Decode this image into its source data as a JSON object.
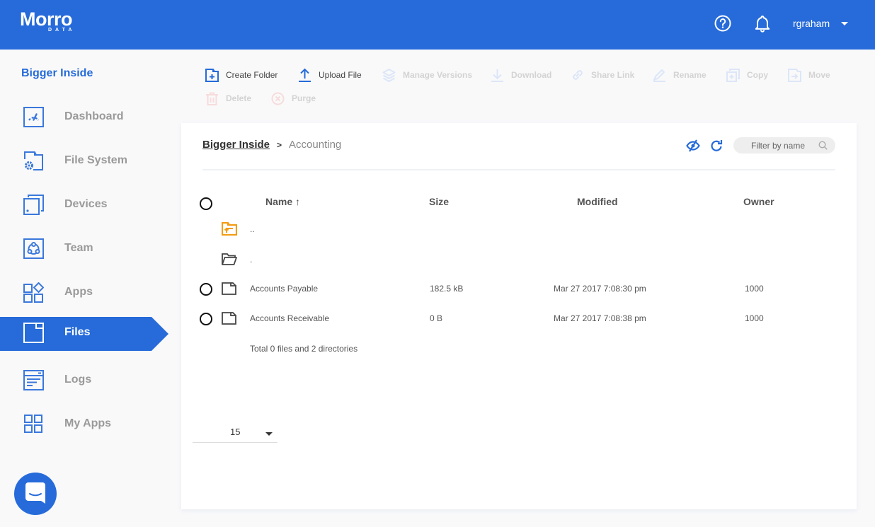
{
  "header": {
    "logo_text": "Morro",
    "logo_subtext": "DATA",
    "username": "rgraham",
    "brand_color": "#266bd9"
  },
  "sidebar": {
    "org_name": "Bigger Inside",
    "items": [
      {
        "label": "Dashboard",
        "icon": "dashboard-icon",
        "active": false
      },
      {
        "label": "File System",
        "icon": "file-system-icon",
        "active": false
      },
      {
        "label": "Devices",
        "icon": "devices-icon",
        "active": false
      },
      {
        "label": "Team",
        "icon": "team-icon",
        "active": false
      },
      {
        "label": "Apps",
        "icon": "apps-icon",
        "active": false
      },
      {
        "label": "Files",
        "icon": "files-icon",
        "active": true
      },
      {
        "label": "Logs",
        "icon": "logs-icon",
        "active": false
      },
      {
        "label": "My Apps",
        "icon": "my-apps-icon",
        "active": false
      }
    ]
  },
  "toolbar": {
    "create_folder": "Create Folder",
    "upload_file": "Upload File",
    "manage_versions": "Manage Versions",
    "download": "Download",
    "share_link": "Share Link",
    "rename": "Rename",
    "copy": "Copy",
    "move": "Move",
    "delete": "Delete",
    "purge": "Purge"
  },
  "breadcrumb": {
    "root": "Bigger Inside",
    "current": "Accounting"
  },
  "filter": {
    "placeholder": "Filter by name"
  },
  "table": {
    "headers": {
      "name": "Name ↑",
      "size": "Size",
      "modified": "Modified",
      "owner": "Owner"
    },
    "parent_dir": "..",
    "current_dir": ".",
    "rows": [
      {
        "name": "Accounts Payable",
        "size": "182.5 kB",
        "modified": "Mar 27 2017 7:08:30 pm",
        "owner": "1000"
      },
      {
        "name": "Accounts Receivable",
        "size": "0 B",
        "modified": "Mar 27 2017 7:08:38 pm",
        "owner": "1000"
      }
    ],
    "total": "Total 0 files and 2 directories"
  },
  "pagination": {
    "page_size": "15"
  }
}
